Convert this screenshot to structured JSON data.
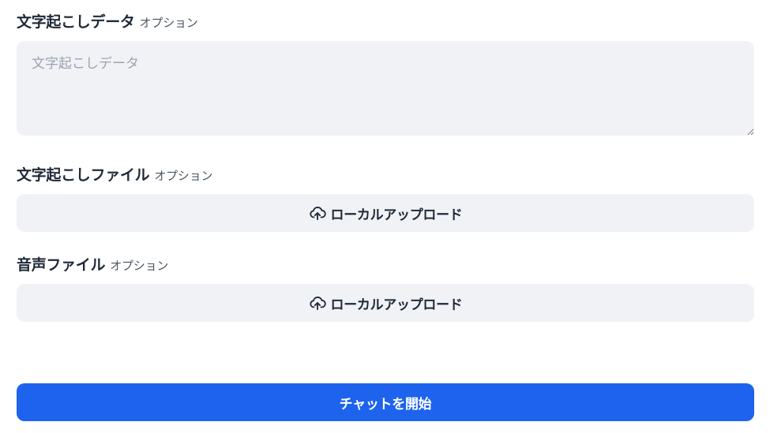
{
  "transcript_text": {
    "label": "文字起こしデータ",
    "optional": "オプション",
    "placeholder": "文字起こしデータ",
    "value": ""
  },
  "transcript_file": {
    "label": "文字起こしファイル",
    "optional": "オプション",
    "upload_label": "ローカルアップロード",
    "icon": "cloud-upload-icon"
  },
  "audio_file": {
    "label": "音声ファイル",
    "optional": "オプション",
    "upload_label": "ローカルアップロード",
    "icon": "cloud-upload-icon"
  },
  "start_button": {
    "label": "チャットを開始"
  },
  "colors": {
    "accent": "#1d63ed",
    "field_bg": "#f0f2f6",
    "text": "#1f2937",
    "muted": "#4b5563",
    "placeholder": "#9ca3af"
  }
}
